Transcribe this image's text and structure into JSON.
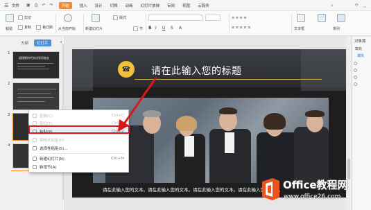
{
  "menubar": {
    "file_label": "文件",
    "tabs": [
      "开始",
      "插入",
      "设计",
      "切换",
      "动画",
      "幻灯片放映",
      "审阅",
      "视图",
      "云服务"
    ],
    "active_tab": "开始"
  },
  "ribbon": {
    "cut": "剪切",
    "copy": "复制",
    "paste": "粘贴",
    "format_painter": "格式刷",
    "from_start": "从当前开始",
    "new_slide": "新建幻灯片",
    "layout": "版式",
    "section": "节",
    "textbox": "文本框",
    "arrange": "排列"
  },
  "left_panel": {
    "tabs": [
      "大纲",
      "幻灯片"
    ],
    "active_tab": "幻灯片",
    "slide_numbers": [
      "1",
      "2",
      "3",
      "4"
    ],
    "thumb1_title": "迎接新时代文化学员结业"
  },
  "slide": {
    "title": "请在此输入您的标题",
    "body_text": "请在此输入您的文本。请在此输入您的文本。请在此输入您的文本。请在此输入您的文本。"
  },
  "context_menu": {
    "items": [
      {
        "label": "复制(C)",
        "shortcut": "Ctrl+C",
        "enabled": false
      },
      {
        "label": "剪切(T)",
        "shortcut": "Ctrl+X",
        "enabled": false
      },
      {
        "label": "粘贴(P)",
        "shortcut": "Ctrl+V",
        "enabled": true,
        "highlighted": true
      },
      {
        "label": "带格式粘贴(H)",
        "shortcut": "",
        "enabled": false
      },
      {
        "label": "选择性粘贴(S)...",
        "shortcut": "",
        "enabled": true
      },
      {
        "label": "新建幻灯片(N)",
        "shortcut": "Ctrl+M",
        "enabled": true
      },
      {
        "label": "新增节(A)",
        "shortcut": "",
        "enabled": true
      }
    ]
  },
  "right_pane": {
    "title": "对象属",
    "tab": "填充",
    "fill_label": "填充"
  },
  "watermark": {
    "brand": "Office教程网",
    "url": "www.office26.com"
  },
  "colors": {
    "accent_orange": "#f18a2e",
    "highlight_red": "#d81919",
    "title_gold": "#f2c236",
    "slide_dark": "#1e1e1e"
  }
}
